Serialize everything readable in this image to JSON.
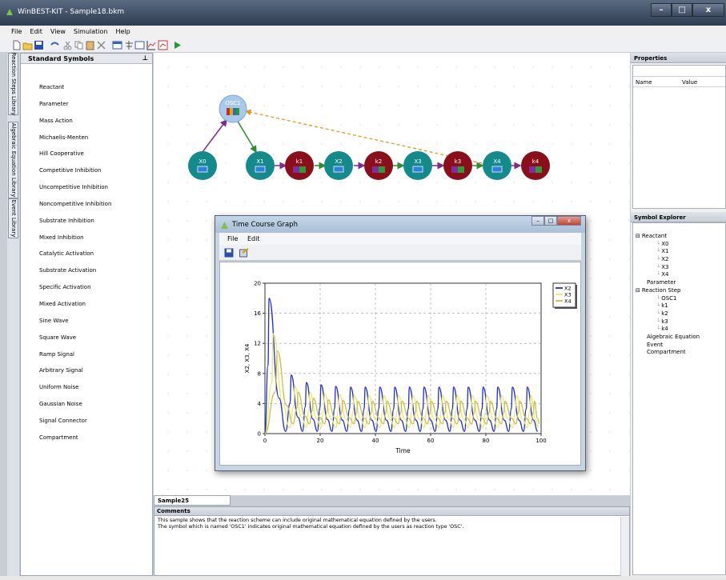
{
  "app": {
    "title": "WinBEST-KIT - Sample18.bkm"
  },
  "window_buttons": {
    "minimize": "–",
    "maximize": "□",
    "close": "x"
  },
  "menu": [
    "File",
    "Edit",
    "View",
    "Simulation",
    "Help"
  ],
  "vertical_tabs": [
    "Reaction Steps Library",
    "Algebraic Equation Library",
    "Event Library"
  ],
  "left_panel": {
    "title": "Standard Symbols",
    "pin": "⊥",
    "items": [
      "Reactant",
      "Parameter",
      "Mass Action",
      "Michaelis-Menten",
      "Hill Cooperative",
      "Competitive Inhibition",
      "Uncompetitive Inhibition",
      "Noncompetitive Inhibition",
      "Substrate Inhibition",
      "Mixed Inhibition",
      "Catalytic Activation",
      "Substrate Activation",
      "Specific Activation",
      "Mixed Activation",
      "Sine Wave",
      "Square Wave",
      "Ramp Signal",
      "Arbitrary Signal",
      "Uniform Noise",
      "Gaussian Noise",
      "Signal Connector",
      "Compartment"
    ]
  },
  "network": {
    "reactants": [
      "X0",
      "X1",
      "X2",
      "X3",
      "X4"
    ],
    "steps": [
      "OSC1",
      "k1",
      "k2",
      "k3",
      "k4"
    ],
    "colors": {
      "reactant": "#148a8a",
      "step": "#8a0f1a",
      "osc": "#a9c9ec"
    }
  },
  "properties": {
    "title": "Properties",
    "col_name": "Name",
    "col_value": "Value"
  },
  "explorer": {
    "title": "Symbol Explorer",
    "tree": [
      {
        "label": "Reactant",
        "level": 0,
        "toggle": "⊟"
      },
      {
        "label": "X0",
        "level": 2
      },
      {
        "label": "X1",
        "level": 2
      },
      {
        "label": "X2",
        "level": 2
      },
      {
        "label": "X3",
        "level": 2
      },
      {
        "label": "X4",
        "level": 2
      },
      {
        "label": "Parameter",
        "level": 1
      },
      {
        "label": "Reaction Step",
        "level": 0,
        "toggle": "⊟"
      },
      {
        "label": "OSC1",
        "level": 2
      },
      {
        "label": "k1",
        "level": 2
      },
      {
        "label": "k2",
        "level": 2
      },
      {
        "label": "k3",
        "level": 2
      },
      {
        "label": "k4",
        "level": 2
      },
      {
        "label": "Algebraic Equation",
        "level": 1
      },
      {
        "label": "Event",
        "level": 1
      },
      {
        "label": "Compartment",
        "level": 1
      }
    ]
  },
  "document_tab": "Sample25",
  "comments": {
    "title": "Comments",
    "lines": [
      "This sample shows that the reaction scheme can include original mathematical equation defined by the users.",
      "The symbol which is named 'OSC1' indicates original mathematical equation defined by the users as reaction type 'OSC'."
    ]
  },
  "graph_window": {
    "title": "Time Course Graph",
    "menu": [
      "File",
      "Edit"
    ]
  },
  "chart_data": {
    "type": "line",
    "xlabel": "Time",
    "ylabel": "X2, X3, X4",
    "xlim": [
      0,
      100
    ],
    "ylim": [
      0,
      20
    ],
    "xticks": [
      "0",
      "20",
      "40",
      "60",
      "80",
      "100"
    ],
    "yticks": [
      "0",
      "4",
      "8",
      "12",
      "16",
      "20"
    ],
    "grid": true,
    "legend_position": "top-right",
    "series": [
      {
        "name": "X2",
        "color": "#1f2ee0",
        "peaks": [
          [
            1.5,
            18
          ],
          [
            9.5,
            7.8
          ],
          [
            15,
            6.8
          ],
          [
            20.3,
            6.5
          ],
          [
            25.6,
            6.3
          ],
          [
            31,
            6.2
          ],
          [
            36.3,
            6.2
          ],
          [
            41.6,
            6.2
          ],
          [
            47,
            6.2
          ],
          [
            52.3,
            6.2
          ],
          [
            57.6,
            6.2
          ],
          [
            63,
            6.2
          ],
          [
            68.3,
            6.2
          ],
          [
            73.6,
            6.2
          ],
          [
            79,
            6.2
          ],
          [
            84.3,
            6.2
          ],
          [
            89.6,
            6.2
          ],
          [
            95,
            6.2
          ]
        ],
        "trough": 0.3
      },
      {
        "name": "X3",
        "color": "#ecea6a",
        "peaks": [
          [
            3,
            13.3
          ],
          [
            10.8,
            6.3
          ],
          [
            16.3,
            5.5
          ],
          [
            21.6,
            5.3
          ],
          [
            27,
            5.2
          ],
          [
            32.3,
            5.1
          ],
          [
            37.6,
            5.1
          ],
          [
            43,
            5.1
          ],
          [
            48.3,
            5.1
          ],
          [
            53.6,
            5.1
          ],
          [
            59,
            5.1
          ],
          [
            64.3,
            5.1
          ],
          [
            69.6,
            5.1
          ],
          [
            75,
            5.1
          ],
          [
            80.3,
            5.1
          ],
          [
            85.6,
            5.1
          ],
          [
            91,
            5.1
          ],
          [
            96.3,
            5.1
          ]
        ],
        "trough": 0.8
      },
      {
        "name": "X4",
        "color": "#c9c04a",
        "peaks": [
          [
            4.5,
            11
          ],
          [
            12,
            5.5
          ],
          [
            17.5,
            4.7
          ],
          [
            22.9,
            4.5
          ],
          [
            28.2,
            4.4
          ],
          [
            33.6,
            4.3
          ],
          [
            38.9,
            4.3
          ],
          [
            44.2,
            4.3
          ],
          [
            49.6,
            4.3
          ],
          [
            54.9,
            4.3
          ],
          [
            60.2,
            4.3
          ],
          [
            65.6,
            4.3
          ],
          [
            70.9,
            4.3
          ],
          [
            76.2,
            4.3
          ],
          [
            81.6,
            4.3
          ],
          [
            86.9,
            4.3
          ],
          [
            92.2,
            4.3
          ],
          [
            97.6,
            4.3
          ]
        ],
        "trough": 1.3
      }
    ]
  }
}
